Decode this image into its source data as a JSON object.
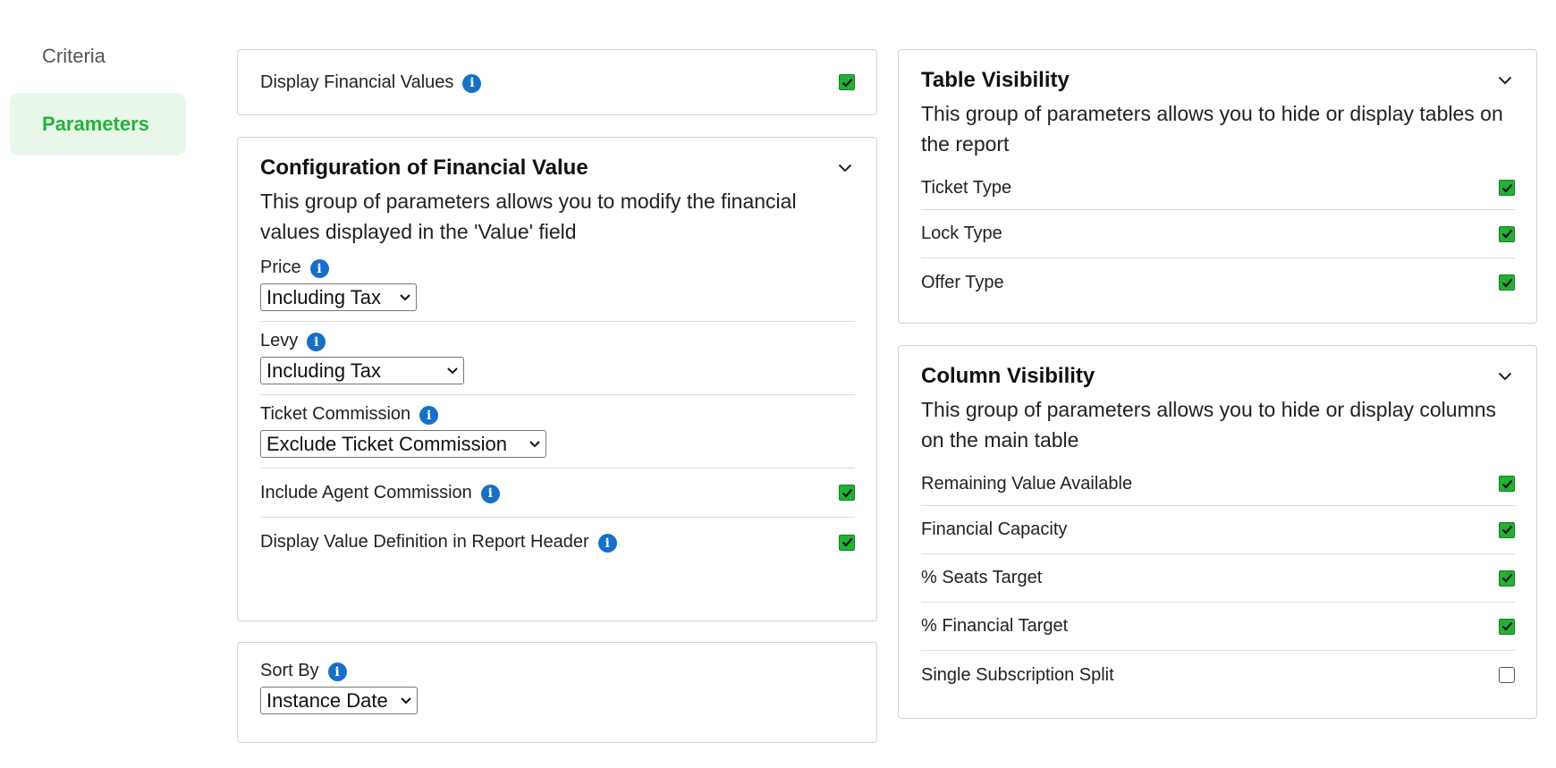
{
  "nav": {
    "items": [
      {
        "label": "Criteria",
        "active": false
      },
      {
        "label": "Parameters",
        "active": true
      }
    ]
  },
  "display_financial": {
    "label": "Display Financial Values",
    "checked": true
  },
  "config_financial": {
    "title": "Configuration of Financial Value",
    "description": "This group of parameters allows you to modify the financial values displayed in the 'Value' field",
    "price": {
      "label": "Price",
      "value": "Including Tax"
    },
    "levy": {
      "label": "Levy",
      "value": "Including Tax"
    },
    "ticket_commission": {
      "label": "Ticket Commission",
      "value": "Exclude Ticket Commission"
    },
    "agent_commission": {
      "label": "Include Agent Commission",
      "checked": true
    },
    "value_definition": {
      "label": "Display Value Definition in Report Header",
      "checked": true
    }
  },
  "sort_by": {
    "label": "Sort By",
    "value": "Instance Date"
  },
  "table_visibility": {
    "title": "Table Visibility",
    "description": "This group of parameters allows you to hide or display tables on the report",
    "items": [
      {
        "label": "Ticket Type",
        "checked": true
      },
      {
        "label": "Lock Type",
        "checked": true
      },
      {
        "label": "Offer Type",
        "checked": true
      }
    ]
  },
  "column_visibility": {
    "title": "Column Visibility",
    "description": "This group of parameters allows you to hide or display columns on the main table",
    "items": [
      {
        "label": "Remaining Value Available",
        "checked": true
      },
      {
        "label": "Financial Capacity",
        "checked": true
      },
      {
        "label": "% Seats Target",
        "checked": true
      },
      {
        "label": "% Financial Target",
        "checked": true
      },
      {
        "label": "Single Subscription Split",
        "checked": false
      }
    ]
  },
  "colors": {
    "accent_green": "#23b33a",
    "checkbox_green": "#1fb233",
    "info_blue": "#1670c8",
    "nav_active_bg": "#e8f7ea"
  }
}
